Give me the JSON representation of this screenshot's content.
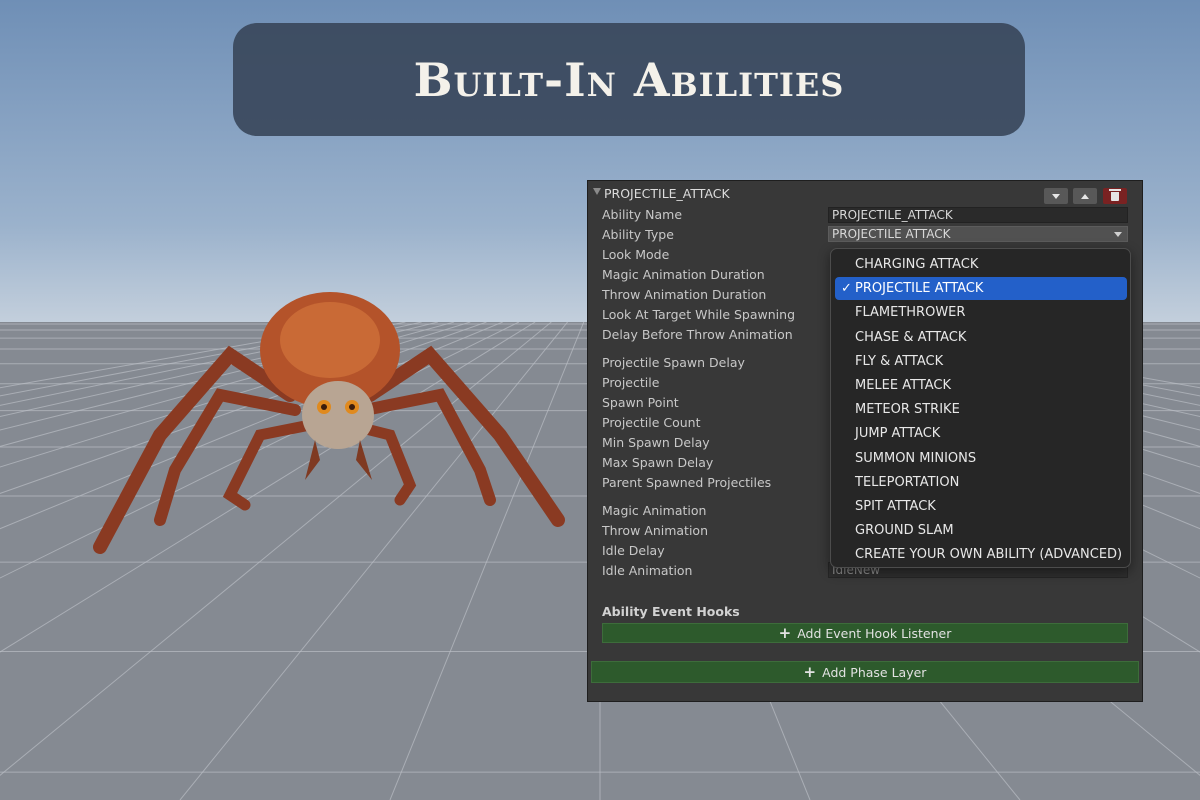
{
  "banner": {
    "title": "Built-In Abilities"
  },
  "panel": {
    "header_title": "PROJECTILE_ATTACK",
    "fields": [
      {
        "label": "Ability Name",
        "value": "PROJECTILE_ATTACK"
      },
      {
        "label": "Ability Type",
        "value": "PROJECTILE ATTACK"
      },
      {
        "label": "Look Mode"
      },
      {
        "label": "Magic Animation Duration"
      },
      {
        "label": "Throw Animation Duration"
      },
      {
        "label": "Look At Target While Spawning"
      },
      {
        "label": "Delay Before Throw Animation"
      },
      {
        "label": "Projectile Spawn Delay"
      },
      {
        "label": "Projectile"
      },
      {
        "label": "Spawn Point"
      },
      {
        "label": "Projectile Count"
      },
      {
        "label": "Min Spawn Delay"
      },
      {
        "label": "Max Spawn Delay"
      },
      {
        "label": "Parent Spawned Projectiles"
      },
      {
        "label": "Magic Animation"
      },
      {
        "label": "Throw Animation"
      },
      {
        "label": "Idle Delay"
      },
      {
        "label": "Idle Animation",
        "value": "IdleNew"
      }
    ],
    "hooks_title": "Ability Event Hooks",
    "add_hook_label": "Add Event Hook Listener",
    "add_phase_label": "Add Phase Layer"
  },
  "dropdown": {
    "selected_index": 1,
    "check_mark": "✓",
    "options": [
      "CHARGING ATTACK",
      "PROJECTILE ATTACK",
      "FLAMETHROWER",
      "CHASE & ATTACK",
      "FLY & ATTACK",
      "MELEE ATTACK",
      "METEOR STRIKE",
      "JUMP ATTACK",
      "SUMMON MINIONS",
      "TELEPORTATION",
      "SPIT ATTACK",
      "GROUND SLAM",
      "CREATE YOUR OWN ABILITY (ADVANCED)"
    ]
  },
  "colors": {
    "panel_bg": "#383838",
    "selected_option": "#2360c9",
    "green_button": "#2d5a2c",
    "delete_button": "#7a2222"
  }
}
